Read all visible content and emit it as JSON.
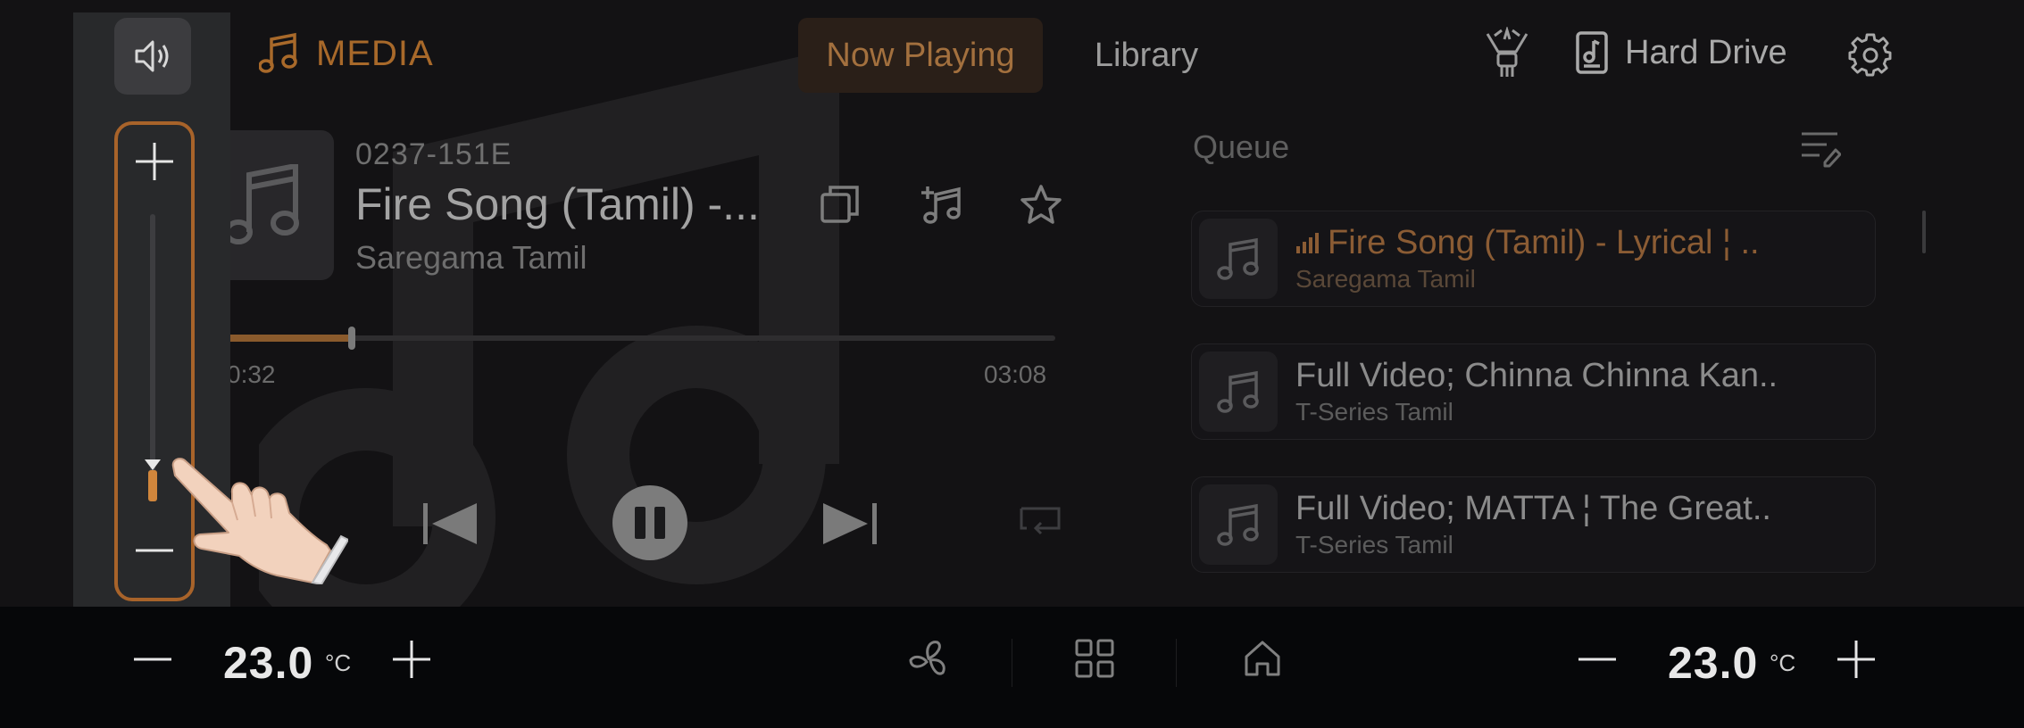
{
  "header": {
    "app_label": "MEDIA",
    "tabs": [
      {
        "label": "Now Playing",
        "active": true
      },
      {
        "label": "Library",
        "active": false
      }
    ],
    "source_label": "Hard Drive",
    "icons": [
      "music-note-icon",
      "equalizer-figure-icon",
      "hard-drive-icon",
      "gear-icon"
    ]
  },
  "now_playing": {
    "code": "0237-151E",
    "title": "Fire Song (Tamil) -...",
    "artist": "Saregama Tamil",
    "elapsed": "0:32",
    "duration": "03:08",
    "progress": 0.17,
    "actions": [
      "copy-icon",
      "add-to-playlist-icon",
      "star-icon"
    ]
  },
  "queue": {
    "label": "Queue",
    "items": [
      {
        "title": "Fire Song (Tamil) - Lyrical ¦ ..",
        "artist": "Saregama Tamil",
        "playing": true
      },
      {
        "title": "Full Video; Chinna Chinna Kan..",
        "artist": "T-Series Tamil",
        "playing": false
      },
      {
        "title": "Full Video; MATTA ¦ The Great..",
        "artist": "T-Series Tamil",
        "playing": false
      }
    ]
  },
  "volume": {
    "level": 0.11
  },
  "climate": {
    "left_temp": "23.0",
    "right_temp": "23.0",
    "unit": "°C"
  },
  "colors": {
    "accent": "#a8632a",
    "volume_fill": "#d1863c",
    "background": "#131214"
  }
}
